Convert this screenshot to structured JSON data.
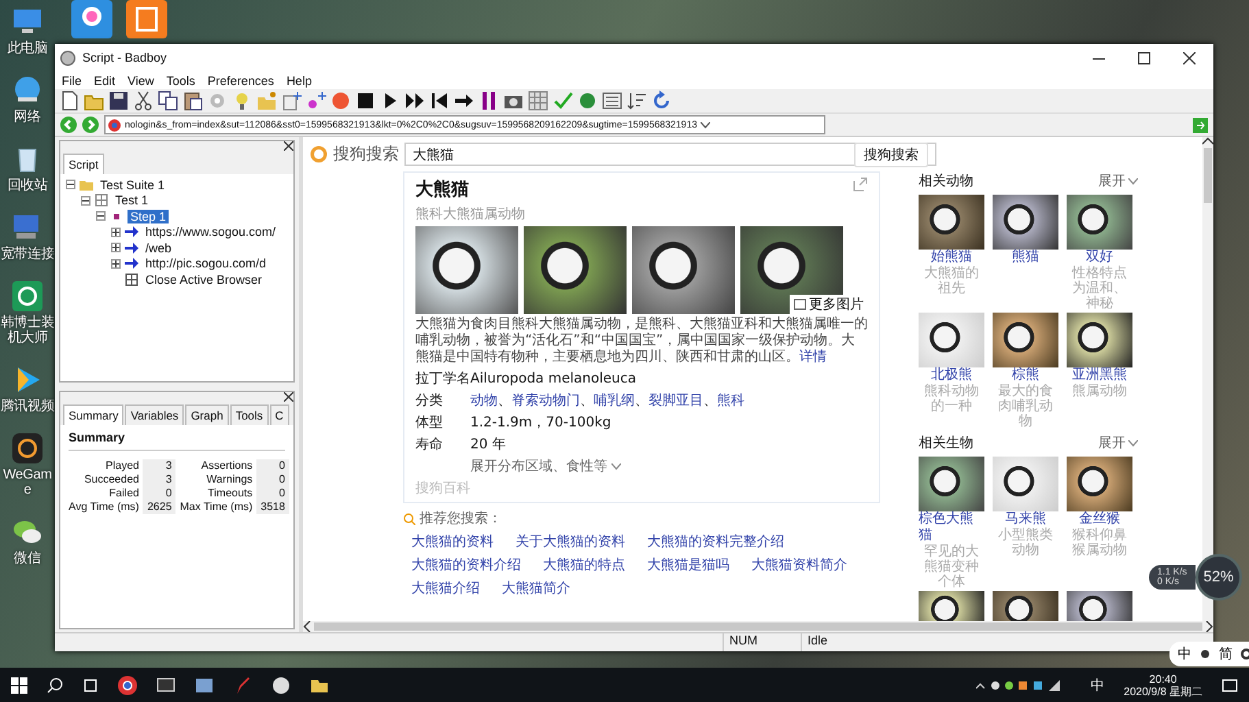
{
  "desktop": {
    "icons": [
      {
        "label": "此电脑",
        "kind": "pc"
      },
      {
        "label": "网络",
        "kind": "globe"
      },
      {
        "label": "回收站",
        "kind": "bin"
      },
      {
        "label": "宽带连接",
        "kind": "net"
      },
      {
        "label": "韩博士装机大师",
        "kind": "app"
      },
      {
        "label": "腾讯视频",
        "kind": "video"
      },
      {
        "label": "WeGame",
        "kind": "game"
      },
      {
        "label": "微信",
        "kind": "chat"
      }
    ]
  },
  "window": {
    "title": "Script - Badboy",
    "menu": [
      "File",
      "Edit",
      "View",
      "Tools",
      "Preferences",
      "Help"
    ],
    "address": "nologin&s_from=index&sut=112086&sst0=1599568321913&lkt=0%2C0%2C0&sugsuv=1599568209162209&sugtime=1599568321913"
  },
  "script_panel": {
    "tab": "Script",
    "tree": [
      {
        "label": "Test Suite 1",
        "kind": "suite",
        "expanded": true,
        "selected": false,
        "children": [
          {
            "label": "Test 1",
            "kind": "test",
            "expanded": true,
            "selected": false,
            "children": [
              {
                "label": "Step 1",
                "kind": "step",
                "expanded": true,
                "selected": true,
                "children": [
                  {
                    "label": "https://www.sogou.com/",
                    "kind": "request",
                    "expanded": false,
                    "selected": false
                  },
                  {
                    "label": "/web",
                    "kind": "request",
                    "expanded": false,
                    "selected": false
                  },
                  {
                    "label": "http://pic.sogou.com/d",
                    "kind": "request",
                    "expanded": false,
                    "selected": false
                  },
                  {
                    "label": "Close Active Browser",
                    "kind": "action",
                    "selected": false
                  }
                ]
              }
            ]
          }
        ]
      }
    ]
  },
  "summary_panel": {
    "tabs": [
      {
        "label": "Summary",
        "selected": true
      },
      {
        "label": "Variables",
        "selected": false
      },
      {
        "label": "Graph",
        "selected": false
      },
      {
        "label": "Tools",
        "selected": false
      },
      {
        "label": "C",
        "selected": false
      }
    ],
    "heading": "Summary",
    "stats": [
      [
        "Played",
        "3",
        "Assertions",
        "0"
      ],
      [
        "Succeeded",
        "3",
        "Warnings",
        "0"
      ],
      [
        "Failed",
        "0",
        "Timeouts",
        "0"
      ],
      [
        "Avg Time (ms)",
        "2625",
        "Max Time (ms)",
        "3518"
      ]
    ]
  },
  "browser": {
    "logo": "搜狗搜索",
    "search": {
      "value": "大熊猫",
      "button": "搜狗搜索"
    },
    "card": {
      "title": "大熊猫",
      "subtitle": "熊科大熊猫属动物",
      "more_photos": "更多图片",
      "description": "大熊猫为食肉目熊科大熊猫属动物，是熊科、大熊猫亚科和大熊猫属唯一的哺乳动物，被誉为“活化石”和“中国国宝”，属中国国家一级保护动物。大熊猫是中国特有物种，主要栖息地为四川、陕西和甘肃的山区。",
      "detail_link": "详情",
      "facts": [
        {
          "label": "拉丁学名",
          "values": [
            "Ailuropoda melanoleuca"
          ],
          "kind": "text"
        },
        {
          "label": "分类",
          "values": [
            "动物",
            "脊索动物门",
            "哺乳纲",
            "裂脚亚目",
            "熊科"
          ],
          "separator": "、",
          "kind": "links"
        },
        {
          "label": "体型",
          "values": [
            "1.2-1.9m，70-100kg"
          ],
          "kind": "text"
        },
        {
          "label": "寿命",
          "values": [
            "20 年"
          ],
          "kind": "text"
        }
      ],
      "expand": "展开分布区域、食性等",
      "source": "搜狗百科"
    },
    "recommend": {
      "title": "推荐您搜索：",
      "links": [
        "大熊猫的资料",
        "关于大熊猫的资料",
        "大熊猫的资料完整介绍",
        "大熊猫的资料介绍",
        "大熊猫的特点",
        "大熊猫是猫吗",
        "大熊猫资料简介",
        "大熊猫介绍",
        "大熊猫简介"
      ]
    },
    "sections": [
      {
        "title": "相关动物",
        "toggle": "展开",
        "items": [
          {
            "kind": "entry",
            "name": "始熊猫",
            "desc": "大熊猫的祖先"
          },
          {
            "kind": "entry",
            "name": "熊猫"
          },
          {
            "kind": "entry",
            "name": "双好",
            "desc": "性格特点为温和、神秘"
          },
          {
            "kind": "entry",
            "name": "北极熊",
            "desc": "熊科动物的一种"
          },
          {
            "kind": "entry",
            "name": "棕熊",
            "desc": "最大的食肉哺乳动物"
          },
          {
            "kind": "entry",
            "name": "亚洲黑熊",
            "desc": "熊属动物"
          }
        ]
      },
      {
        "title": "相关生物",
        "toggle": "展开",
        "items": [
          {
            "kind": "entry",
            "name": "棕色大熊猫",
            "desc": "罕见的大熊猫变种个体"
          },
          {
            "kind": "entry",
            "name": "马来熊",
            "desc": "小型熊类动物"
          },
          {
            "kind": "entry",
            "name": "金丝猴",
            "desc": "猴科仰鼻猴属动物"
          },
          {
            "kind": "photo"
          },
          {
            "kind": "photo"
          },
          {
            "kind": "photo"
          }
        ]
      }
    ]
  },
  "status_bar": [
    "NUM",
    "Idle"
  ],
  "overlay": {
    "up": "1.1 K/s",
    "down": "0 K/s",
    "percent": "52%"
  },
  "ime": [
    "中",
    "简"
  ],
  "taskbar": {
    "time": "20:40",
    "date": "2020/9/8 星期二",
    "ime": "中"
  }
}
